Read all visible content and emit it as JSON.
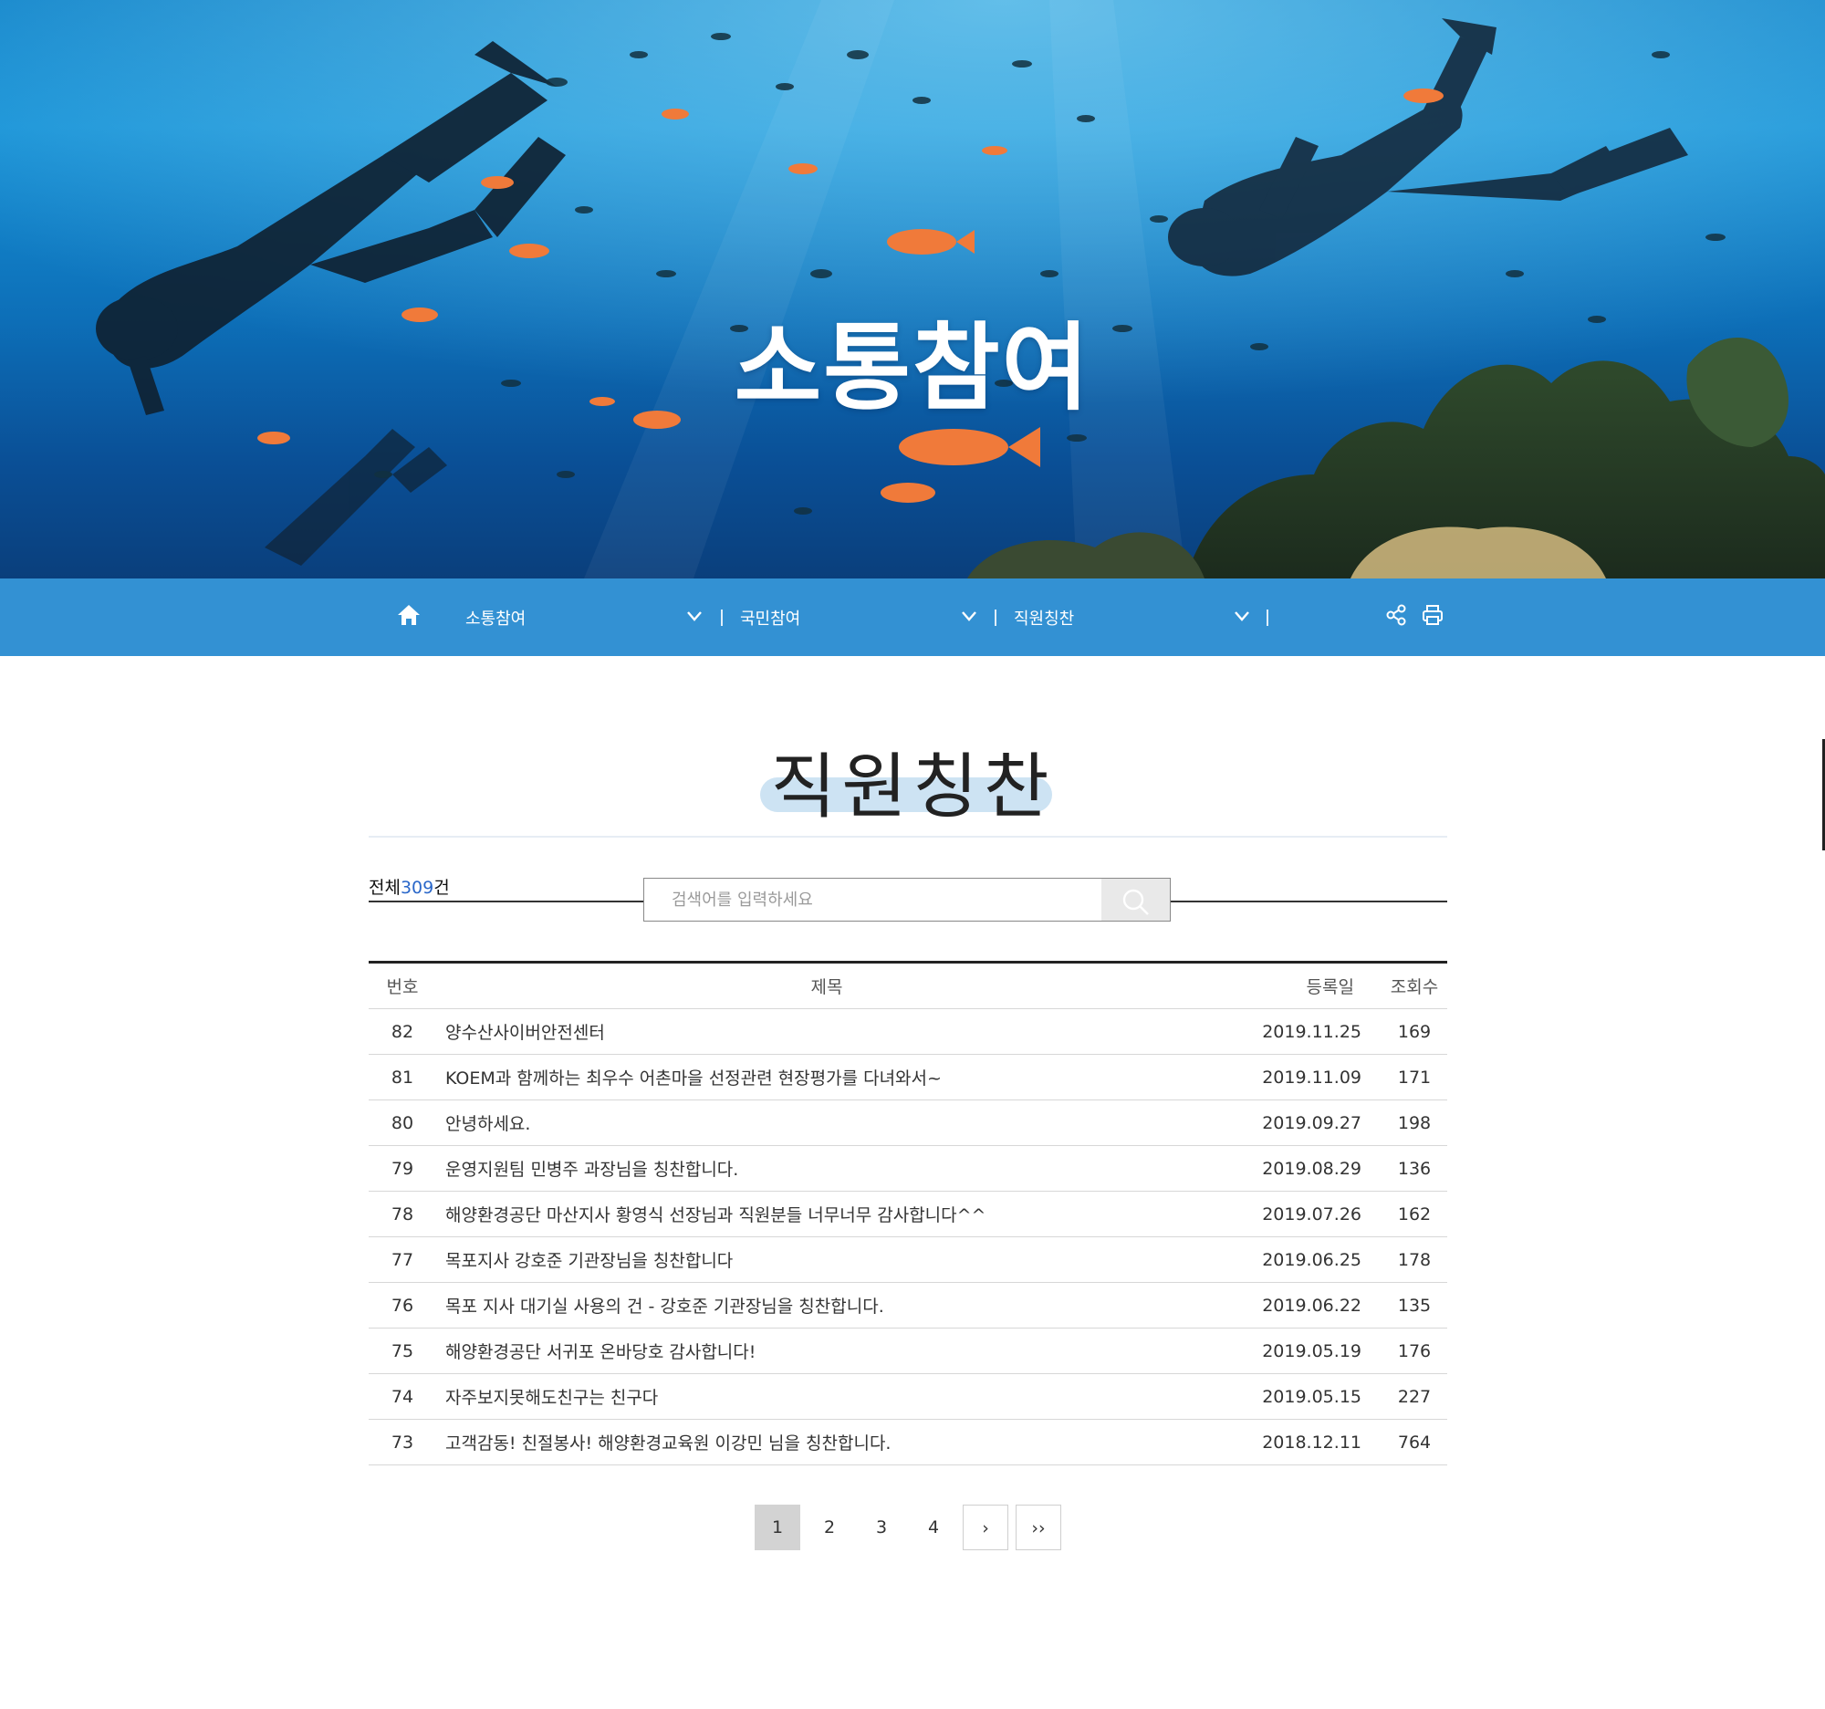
{
  "hero": {
    "title": "소통참여"
  },
  "nav": {
    "home_icon": "home-icon",
    "menus": [
      {
        "label": "소통참여",
        "icon": "chevron-down-icon"
      },
      {
        "label": "국민참여",
        "icon": "chevron-down-icon"
      },
      {
        "label": "직원칭찬",
        "icon": "chevron-down-icon"
      }
    ],
    "tools": [
      "share-icon",
      "print-icon"
    ]
  },
  "page": {
    "title": "직원칭찬"
  },
  "board": {
    "total_prefix": "전체",
    "total_count": "309",
    "total_suffix": "건",
    "search": {
      "placeholder": "검색어를 입력하세요",
      "value": "",
      "button_icon": "search-icon"
    },
    "columns": [
      "번호",
      "제목",
      "등록일",
      "조회수"
    ],
    "rows": [
      {
        "no": "82",
        "title": "양수산사이버안전센터",
        "date": "2019.11.25",
        "views": "169"
      },
      {
        "no": "81",
        "title": "KOEM과 함께하는 최우수 어촌마을 선정관련 현장평가를 다녀와서~",
        "date": "2019.11.09",
        "views": "171"
      },
      {
        "no": "80",
        "title": "안녕하세요.",
        "date": "2019.09.27",
        "views": "198"
      },
      {
        "no": "79",
        "title": "운영지원팀 민병주 과장님을 칭찬합니다.",
        "date": "2019.08.29",
        "views": "136"
      },
      {
        "no": "78",
        "title": "해양환경공단 마산지사 황영식 선장님과 직원분들 너무너무 감사합니다^^",
        "date": "2019.07.26",
        "views": "162"
      },
      {
        "no": "77",
        "title": "목포지사 강호준 기관장님을 칭찬합니다",
        "date": "2019.06.25",
        "views": "178"
      },
      {
        "no": "76",
        "title": "목포 지사 대기실 사용의 건 - 강호준 기관장님을 칭찬합니다.",
        "date": "2019.06.22",
        "views": "135"
      },
      {
        "no": "75",
        "title": "해양환경공단 서귀포 온바당호 감사합니다!",
        "date": "2019.05.19",
        "views": "176"
      },
      {
        "no": "74",
        "title": "자주보지못해도친구는 친구다",
        "date": "2019.05.15",
        "views": "227"
      },
      {
        "no": "73",
        "title": "고객감동! 친절봉사! 해양환경교육원 이강민 님을 칭찬합니다.",
        "date": "2018.12.11",
        "views": "764"
      }
    ]
  },
  "pagination": {
    "pages": [
      "1",
      "2",
      "3",
      "4"
    ],
    "current": "1",
    "next_label": "›",
    "last_label": "››"
  },
  "colors": {
    "nav_bg": "#3391d3",
    "title_highlight": "#cde3f3",
    "count_accent": "#2a67c9",
    "active_page_bg": "#d3d3d3"
  }
}
